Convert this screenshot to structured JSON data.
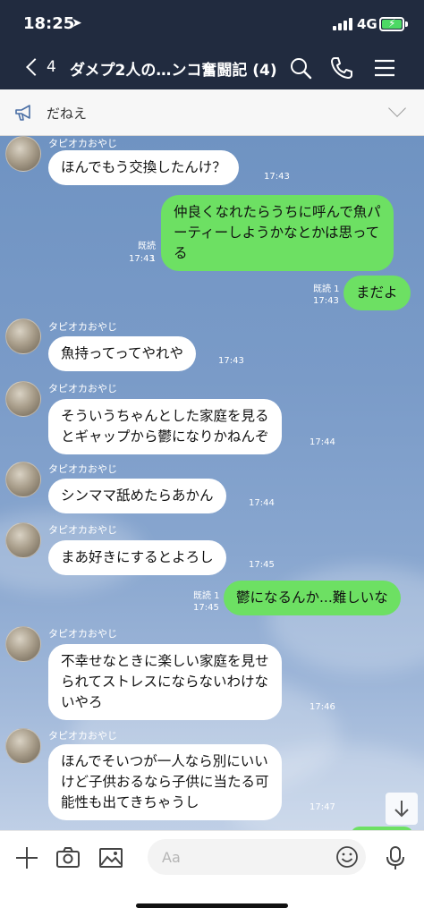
{
  "status_bar": {
    "time": "18:25",
    "location_glyph": "➤",
    "network": "4G"
  },
  "nav": {
    "back_count": "4",
    "title": "ダメプ2人の…ンコ奮闘記 (4)"
  },
  "announcement": {
    "text": "だねえ"
  },
  "messages": [
    {
      "sender": "タピオカおやじ",
      "lines": [
        "ほんでもう交換したんけ？"
      ],
      "time": "17:43"
    },
    {
      "lines": [
        "仲良くなれたらうちに呼んで魚パ",
        "ーティーしようかなとかは思って",
        "る"
      ],
      "read": "既読 1",
      "time": "17:43"
    },
    {
      "lines": [
        "まだよ"
      ],
      "read": "既読 1",
      "time": "17:43"
    },
    {
      "sender": "タピオカおやじ",
      "lines": [
        "魚持ってってやれや"
      ],
      "time": "17:43"
    },
    {
      "sender": "タピオカおやじ",
      "lines": [
        "そういうちゃんとした家庭を見る",
        "とギャップから鬱になりかねんぞ"
      ],
      "time": "17:44"
    },
    {
      "sender": "タピオカおやじ",
      "lines": [
        "シンママ舐めたらあかん"
      ],
      "time": "17:44"
    },
    {
      "sender": "タピオカおやじ",
      "lines": [
        "まあ好きにするとよろし"
      ],
      "time": "17:45"
    },
    {
      "lines": [
        "鬱になるんか...難しいな"
      ],
      "read": "既読 1",
      "time": "17:45"
    },
    {
      "sender": "タピオカおやじ",
      "lines": [
        "不幸せなときに楽しい家庭を見せ",
        "られてストレスにならないわけな",
        "いやろ"
      ],
      "time": "17:46"
    },
    {
      "sender": "タピオカおやじ",
      "lines": [
        "ほんでそいつが一人なら別にいい",
        "けど子供おるなら子供に当たる可",
        "能性も出てきちゃうし"
      ],
      "time": "17:47"
    }
  ],
  "input": {
    "placeholder": "Aa"
  },
  "colors": {
    "header_bg": "#212b3f",
    "outgoing_bubble": "#6de063",
    "incoming_bubble": "#ffffff",
    "chat_bg": "#7a9bc8",
    "battery_fill": "#4cd964"
  },
  "icons": [
    "location-arrow-icon",
    "signal-icon",
    "battery-icon",
    "back-chevron-icon",
    "search-icon",
    "phone-icon",
    "menu-icon",
    "megaphone-icon",
    "chevron-down-icon",
    "arrow-down-icon",
    "plus-icon",
    "camera-icon",
    "image-icon",
    "emoji-icon",
    "microphone-icon"
  ]
}
